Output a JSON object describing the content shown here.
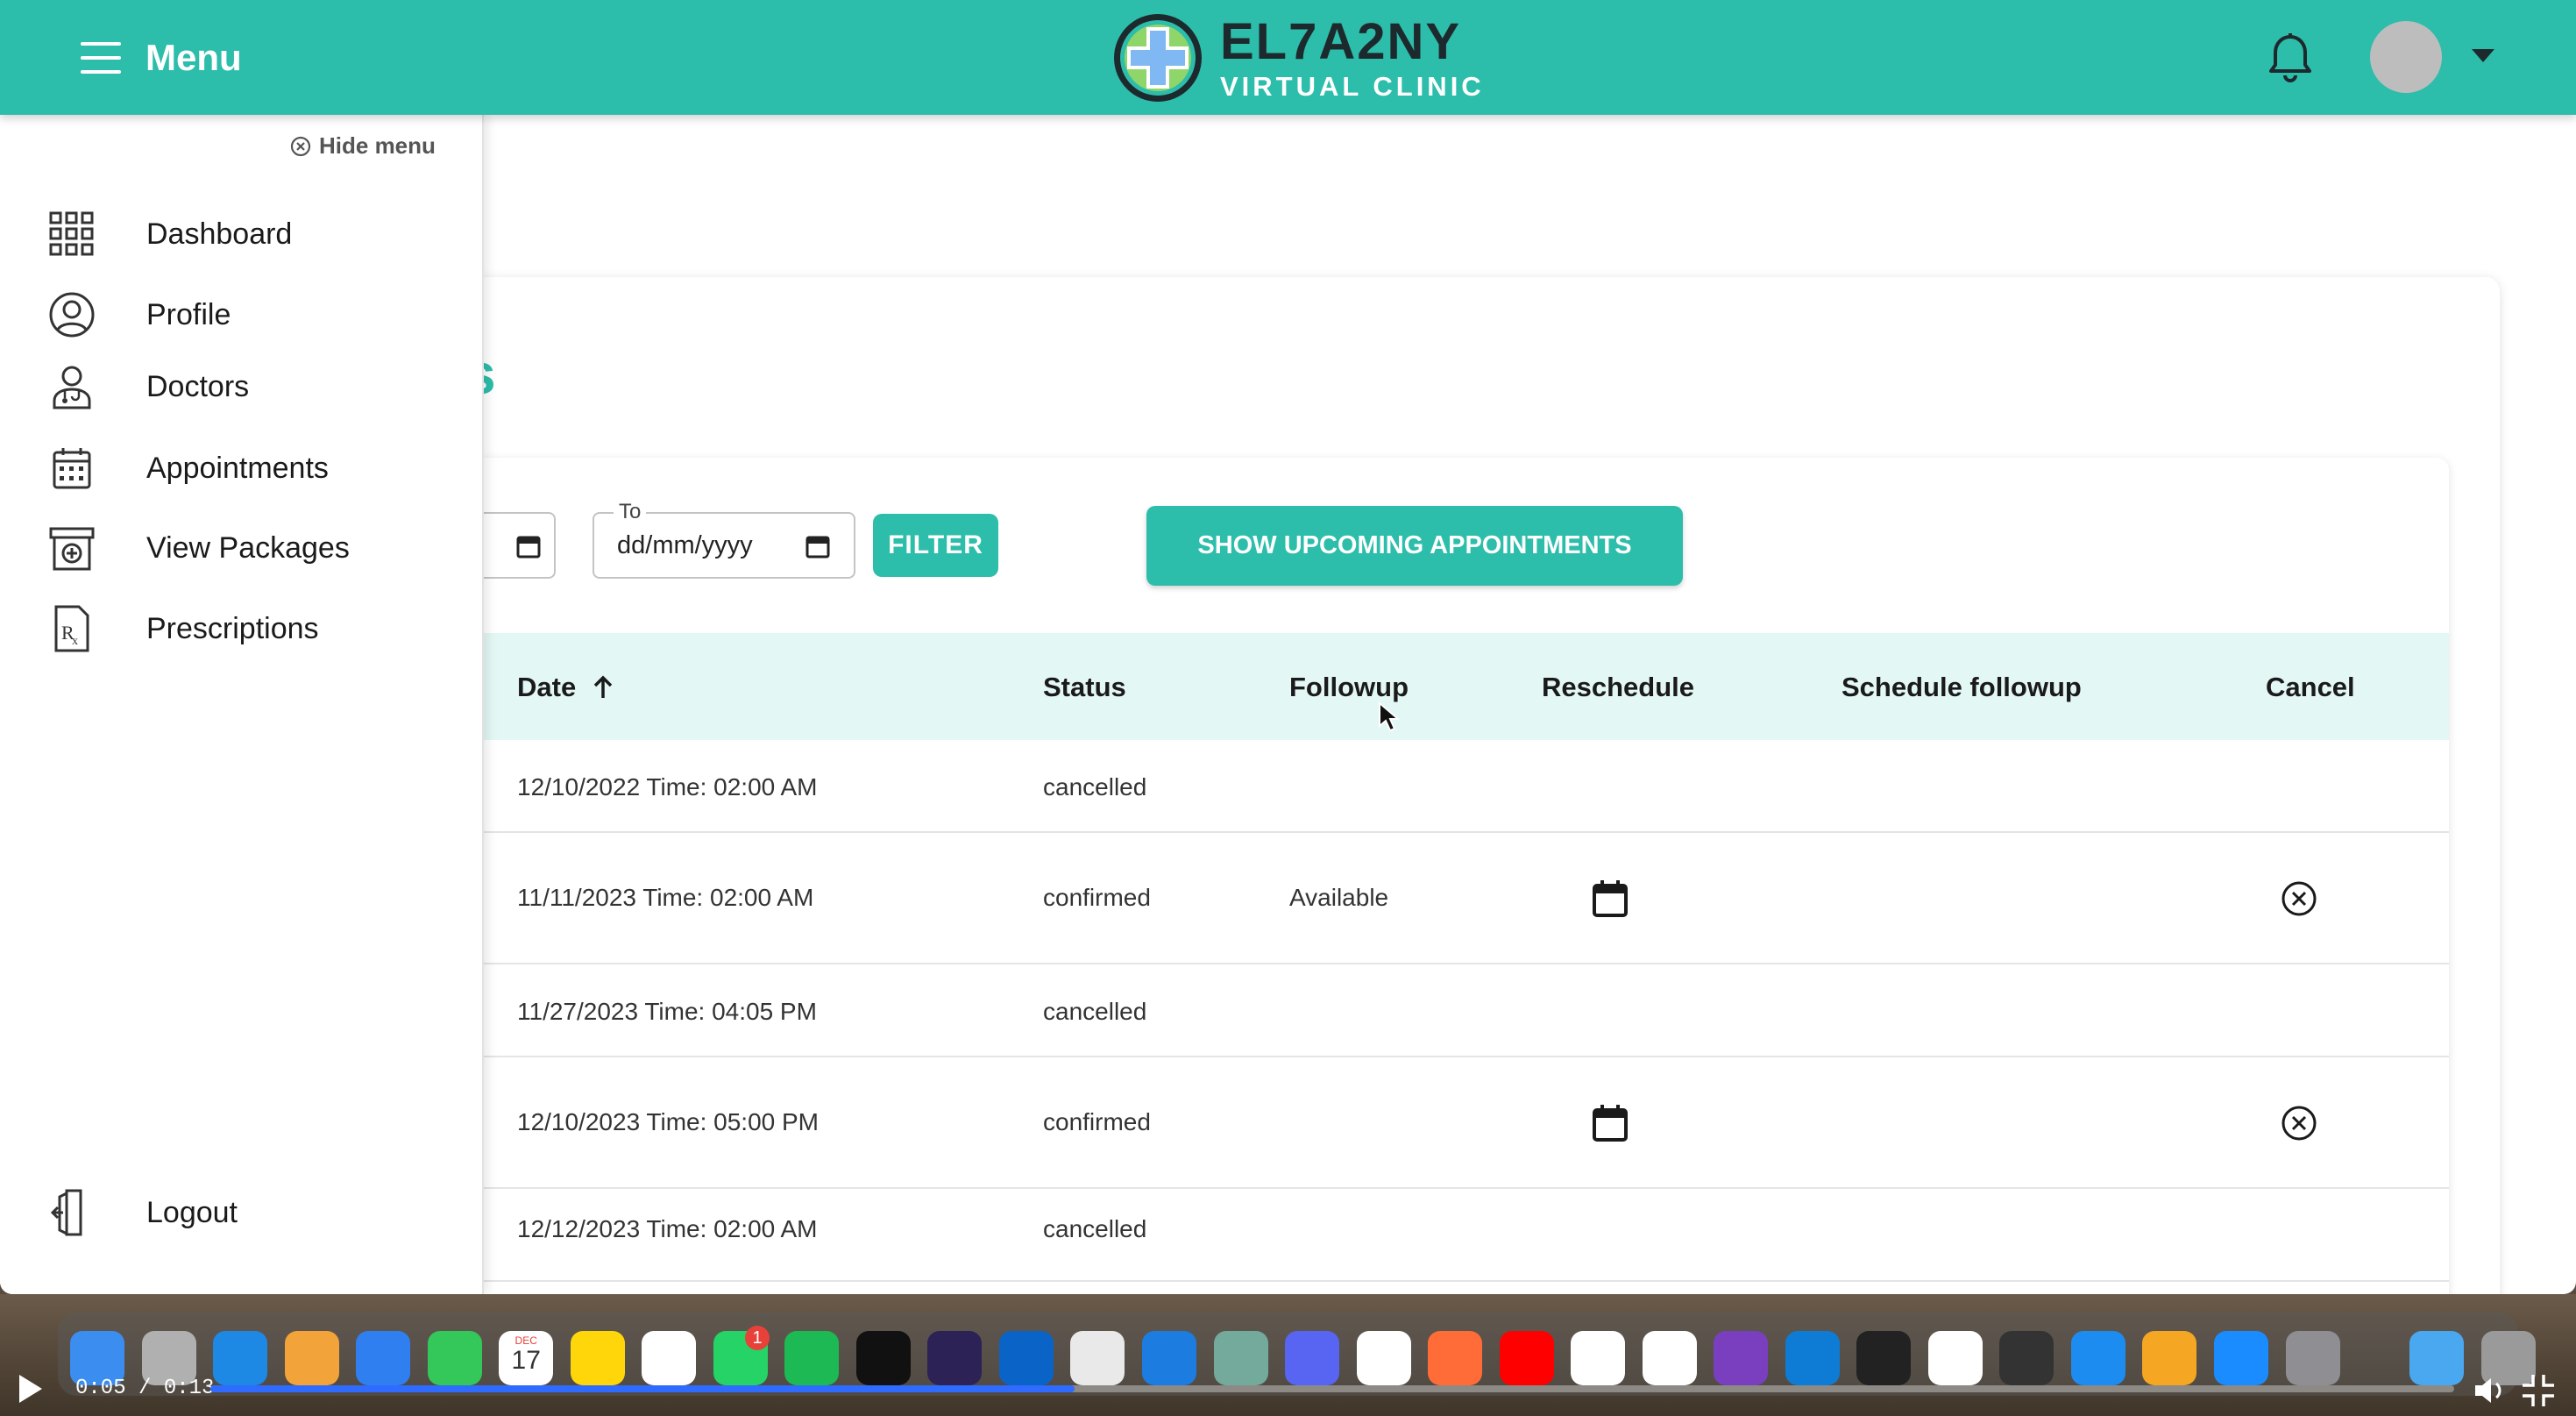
{
  "header": {
    "menu_label": "Menu",
    "brand_title": "EL7A2NY",
    "brand_subtitle": "VIRTUAL CLINIC"
  },
  "sidebar": {
    "hide_label": "Hide menu",
    "items": [
      {
        "label": "Dashboard",
        "icon": "grid-icon"
      },
      {
        "label": "Profile",
        "icon": "user-circle-icon"
      },
      {
        "label": "Doctors",
        "icon": "doctor-icon"
      },
      {
        "label": "Appointments",
        "icon": "calendar-icon"
      },
      {
        "label": "View Packages",
        "icon": "package-icon"
      },
      {
        "label": "Prescriptions",
        "icon": "prescription-icon"
      }
    ],
    "logout_label": "Logout"
  },
  "page": {
    "title_visible": "ents"
  },
  "filters": {
    "to_legend": "To",
    "to_value": "dd/mm/yyyy",
    "filter_label": "FILTER",
    "upcoming_label": "SHOW UPCOMING APPOINTMENTS"
  },
  "table": {
    "headers": {
      "date": "Date",
      "status": "Status",
      "followup": "Followup",
      "reschedule": "Reschedule",
      "schedule_followup": "Schedule followup",
      "cancel": "Cancel"
    },
    "rows": [
      {
        "date": "12/10/2022 Time: 02:00 AM",
        "status": "cancelled",
        "followup": "",
        "reschedule": false,
        "cancel": false
      },
      {
        "date": "11/11/2023 Time: 02:00 AM",
        "status": "confirmed",
        "followup": "Available",
        "reschedule": true,
        "cancel": true
      },
      {
        "date": "11/27/2023 Time: 04:05 PM",
        "status": "cancelled",
        "followup": "",
        "reschedule": false,
        "cancel": false
      },
      {
        "date": "12/10/2023 Time: 05:00 PM",
        "status": "confirmed",
        "followup": "",
        "reschedule": true,
        "cancel": true
      },
      {
        "date": "12/12/2023 Time: 02:00 AM",
        "status": "cancelled",
        "followup": "",
        "reschedule": false,
        "cancel": false
      }
    ]
  },
  "colors": {
    "brand": "#2dbdab",
    "header_row": "#e3f7f4"
  },
  "dock": {
    "whatsapp_badge": "1",
    "calendar_month": "DEC",
    "calendar_day": "17"
  },
  "video": {
    "time": "0:05 / 0:13",
    "progress_fraction": 0.385
  }
}
